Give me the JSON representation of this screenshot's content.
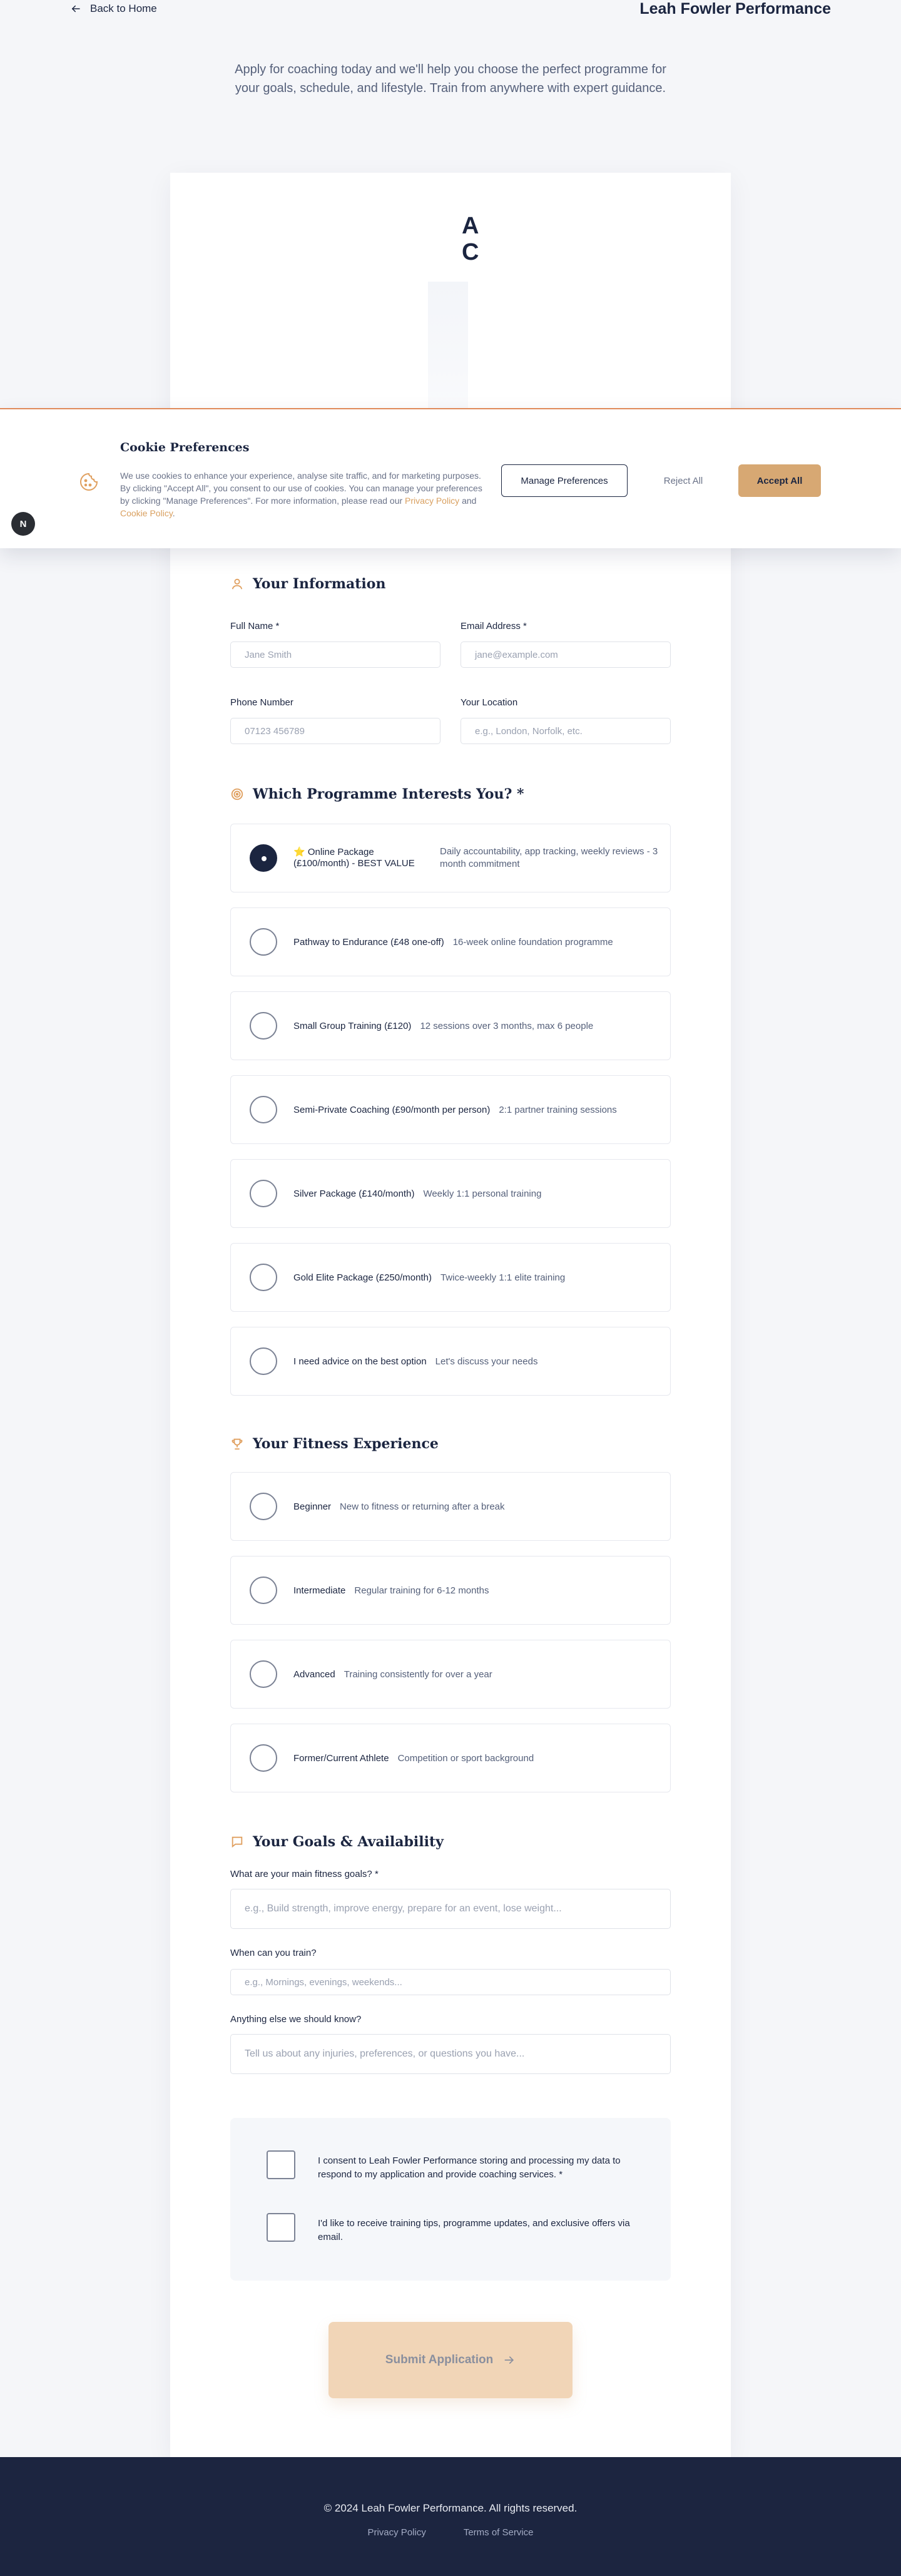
{
  "header": {
    "back_label": "Back to Home",
    "brand": "Leah Fowler Performance"
  },
  "intro": "Apply for coaching today and we'll help you choose the perfect programme for your goals, schedule, and lifestyle. Train from anywhere with expert guidance.",
  "card_heading_fragment": "A\nC",
  "cookie": {
    "title": "Cookie Preferences",
    "text_before": "We use cookies to enhance your experience, analyse site traffic, and for marketing purposes. By clicking \"Accept All\", you consent to our use of cookies. You can manage your preferences by clicking \"Manage Preferences\". For more information, please read our ",
    "privacy_link": "Privacy Policy",
    "and": " and ",
    "cookie_link": "Cookie Policy",
    "end": ".",
    "manage_label": "Manage Preferences",
    "reject_label": "Reject All",
    "accept_label": "Accept All"
  },
  "fab_label": "N",
  "info": {
    "title": "Your Information",
    "full_name_label": "Full Name *",
    "full_name_placeholder": "Jane Smith",
    "email_label": "Email Address *",
    "email_placeholder": "jane@example.com",
    "phone_label": "Phone Number",
    "phone_placeholder": "07123 456789",
    "location_label": "Your Location",
    "location_placeholder": "e.g., London, Norfolk, etc."
  },
  "programmes": {
    "title": "Which Programme Interests You? *",
    "options": [
      {
        "label": "⭐ Online Package (£100/month) - BEST VALUE",
        "desc": "Daily accountability, app tracking, weekly reviews - 3 month commitment",
        "selected": true
      },
      {
        "label": "Pathway to Endurance (£48 one-off)",
        "desc": "16-week online foundation programme",
        "selected": false
      },
      {
        "label": "Small Group Training (£120)",
        "desc": "12 sessions over 3 months, max 6 people",
        "selected": false
      },
      {
        "label": "Semi-Private Coaching (£90/month per person)",
        "desc": "2:1 partner training sessions",
        "selected": false
      },
      {
        "label": "Silver Package (£140/month)",
        "desc": "Weekly 1:1 personal training",
        "selected": false
      },
      {
        "label": "Gold Elite Package (£250/month)",
        "desc": "Twice-weekly 1:1 elite training",
        "selected": false
      },
      {
        "label": "I need advice on the best option",
        "desc": "Let's discuss your needs",
        "selected": false
      }
    ]
  },
  "experience": {
    "title": "Your Fitness Experience",
    "options": [
      {
        "label": "Beginner",
        "desc": "New to fitness or returning after a break"
      },
      {
        "label": "Intermediate",
        "desc": "Regular training for 6-12 months"
      },
      {
        "label": "Advanced",
        "desc": "Training consistently for over a year"
      },
      {
        "label": "Former/Current Athlete",
        "desc": "Competition or sport background"
      }
    ]
  },
  "goals": {
    "title": "Your Goals & Availability",
    "goals_label": "What are your main fitness goals? *",
    "goals_placeholder": "e.g., Build strength, improve energy, prepare for an event, lose weight...",
    "train_label": "When can you train?",
    "train_placeholder": "e.g., Mornings, evenings, weekends...",
    "else_label": "Anything else we should know?",
    "else_placeholder": "Tell us about any injuries, preferences, or questions you have..."
  },
  "consent": {
    "data": "I consent to Leah Fowler Performance storing and processing my data to respond to my application and provide coaching services. *",
    "marketing": "I'd like to receive training tips, programme updates, and exclusive offers via email."
  },
  "submit_label": "Submit Application",
  "footer": {
    "copyright": "© 2024 Leah Fowler Performance. All rights reserved.",
    "privacy": "Privacy Policy",
    "terms": "Terms of Service"
  },
  "colors": {
    "navy": "#1b2540",
    "accent": "#d7a873",
    "accent_icon": "#e0a060",
    "footer_bg": "#1c2540"
  }
}
